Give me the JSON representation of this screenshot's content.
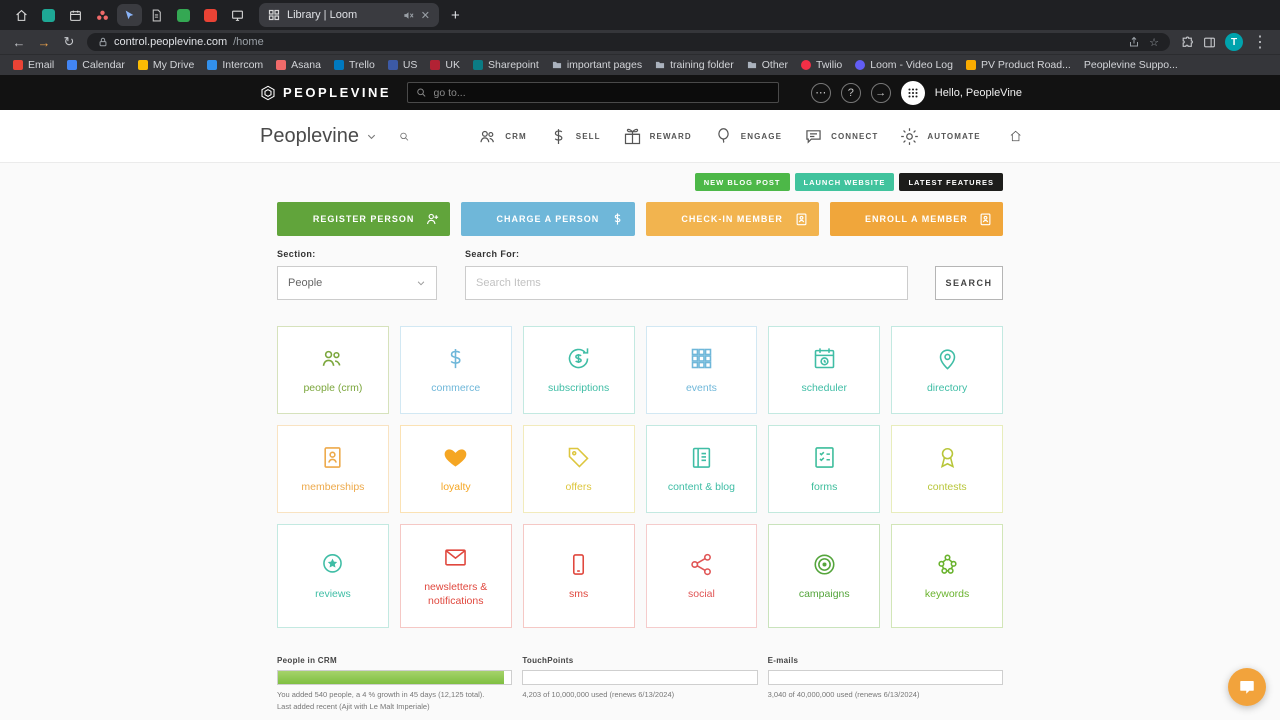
{
  "browser": {
    "active_tab_title": "Library | Loom",
    "url_domain": "control.peoplevine.com",
    "url_path": "/home",
    "profile_initial": "T",
    "bookmarks": [
      {
        "label": "Email",
        "color": "#ea4335"
      },
      {
        "label": "Calendar",
        "color": "#4285f4"
      },
      {
        "label": "My Drive",
        "color": "#fbbc04"
      },
      {
        "label": "Intercom",
        "color": "#3290ec"
      },
      {
        "label": "Asana",
        "color": "#f06a6a"
      },
      {
        "label": "Trello",
        "color": "#0079bf"
      },
      {
        "label": "US",
        "color": "#3c5aa6"
      },
      {
        "label": "UK",
        "color": "#b22234"
      },
      {
        "label": "Sharepoint",
        "color": "#0b7b84"
      },
      {
        "label": "important pages",
        "color": "folder"
      },
      {
        "label": "training folder",
        "color": "folder"
      },
      {
        "label": "Other",
        "color": "folder"
      },
      {
        "label": "Twilio",
        "color": "#f22f46"
      },
      {
        "label": "Loom - Video Log",
        "color": "#625df5"
      },
      {
        "label": "PV Product Road...",
        "color": "#f9ab00"
      },
      {
        "label": "Peoplevine Suppo...",
        "color": "#9aa0a6"
      }
    ]
  },
  "header": {
    "logo": "PEOPLEVINE",
    "search_placeholder": "go to...",
    "greeting": "Hello, PeopleVine"
  },
  "nav": {
    "brand": "Peoplevine",
    "items": [
      {
        "label": "CRM",
        "icon": "people-icon"
      },
      {
        "label": "SELL",
        "icon": "dollar-icon"
      },
      {
        "label": "REWARD",
        "icon": "gift-icon"
      },
      {
        "label": "ENGAGE",
        "icon": "balloon-icon"
      },
      {
        "label": "CONNECT",
        "icon": "chat-icon"
      },
      {
        "label": "AUTOMATE",
        "icon": "gear-icon"
      }
    ]
  },
  "quick_links": [
    {
      "label": "NEW BLOG POST",
      "color": "#4db848"
    },
    {
      "label": "LAUNCH WEBSITE",
      "color": "#41c39d"
    },
    {
      "label": "LATEST FEATURES",
      "color": "#1d1d1b"
    }
  ],
  "actions": [
    {
      "label": "REGISTER PERSON",
      "color": "#61a43b",
      "icon": "person-add-icon"
    },
    {
      "label": "CHARGE A PERSON",
      "color": "#6fb7d9",
      "icon": "dollar-icon"
    },
    {
      "label": "CHECK-IN MEMBER",
      "color": "#f2b44f",
      "icon": "badge-icon"
    },
    {
      "label": "ENROLL A MEMBER",
      "color": "#f0a63b",
      "icon": "badge-icon"
    }
  ],
  "search_panel": {
    "section_label": "Section:",
    "section_value": "People",
    "search_label": "Search For:",
    "search_placeholder": "Search Items",
    "search_button": "SEARCH"
  },
  "tiles": [
    {
      "label": "people (crm)",
      "color": "#7ba63c",
      "icon": "people-icon"
    },
    {
      "label": "commerce",
      "color": "#6fb7d9",
      "icon": "dollar-icon"
    },
    {
      "label": "subscriptions",
      "color": "#3fbda5",
      "icon": "recurring-dollar-icon"
    },
    {
      "label": "events",
      "color": "#6fb7d9",
      "icon": "grid-icon"
    },
    {
      "label": "scheduler",
      "color": "#3fbda5",
      "icon": "calendar-clock-icon"
    },
    {
      "label": "directory",
      "color": "#3fbda5",
      "icon": "map-pin-icon"
    },
    {
      "label": "memberships",
      "color": "#eda94a",
      "icon": "id-card-icon"
    },
    {
      "label": "loyalty",
      "color": "#f5a623",
      "icon": "heart-icon"
    },
    {
      "label": "offers",
      "color": "#ddc63e",
      "icon": "tag-icon"
    },
    {
      "label": "content & blog",
      "color": "#3fbda5",
      "icon": "notebook-icon"
    },
    {
      "label": "forms",
      "color": "#3cbd9b",
      "icon": "checklist-icon"
    },
    {
      "label": "contests",
      "color": "#b8c63a",
      "icon": "award-icon"
    },
    {
      "label": "reviews",
      "color": "#3fbda5",
      "icon": "star-badge-icon"
    },
    {
      "label": "newsletters & notifications",
      "color": "#e0483e",
      "icon": "envelope-icon"
    },
    {
      "label": "sms",
      "color": "#e0483e",
      "icon": "phone-icon"
    },
    {
      "label": "social",
      "color": "#e05555",
      "icon": "share-nodes-icon"
    },
    {
      "label": "campaigns",
      "color": "#55a53c",
      "icon": "bullseye-icon"
    },
    {
      "label": "keywords",
      "color": "#6ab32e",
      "icon": "cluster-icon"
    }
  ],
  "stats": [
    {
      "title": "People in CRM",
      "fill": "width:97%",
      "line1": "You added 540 people, a 4 % growth in 45 days (12,125 total).",
      "line2": "Last added recent (Ajit with Le Malt Imperiale)"
    },
    {
      "title": "TouchPoints",
      "fill": "width:0%",
      "line1": "4,203 of 10,000,000 used (renews 6/13/2024)",
      "line2": ""
    },
    {
      "title": "E-mails",
      "fill": "width:0%",
      "line1": "3,040 of 40,000,000 used (renews 6/13/2024)",
      "line2": ""
    }
  ]
}
